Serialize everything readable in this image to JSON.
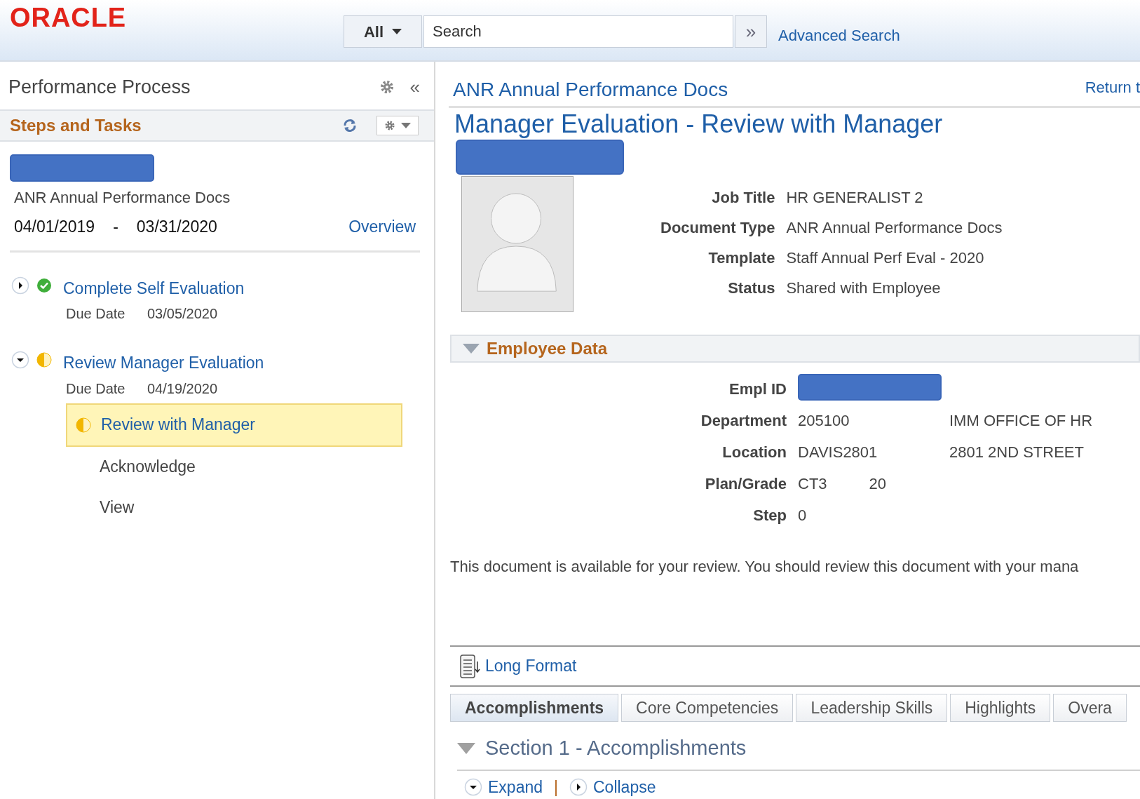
{
  "header": {
    "logo": "ORACLE",
    "search_scope": "All",
    "search": {
      "placeholder": "Search"
    },
    "search_go": "»",
    "advanced_search": "Advanced Search"
  },
  "sidebar": {
    "title": "Performance Process",
    "collapse": "«",
    "section": "Steps and Tasks",
    "document": "ANR Annual Performance Docs",
    "period_start": "04/01/2019",
    "period_sep": "-",
    "period_end": "03/31/2020",
    "overview": "Overview",
    "tasks": [
      {
        "title": "Complete Self Evaluation",
        "kind": "complete",
        "expanded": false,
        "due_label": "Due Date",
        "due": "03/05/2020"
      },
      {
        "title": "Review Manager Evaluation",
        "kind": "partial",
        "expanded": true,
        "due_label": "Due Date",
        "due": "04/19/2020",
        "steps": [
          {
            "label": "Review with Manager",
            "selected": true,
            "kind": "partial"
          },
          {
            "label": "Acknowledge",
            "selected": false,
            "kind": "pending"
          },
          {
            "label": "View",
            "selected": false,
            "kind": "pending"
          }
        ]
      }
    ]
  },
  "main": {
    "breadcrumb": "ANR Annual Performance Docs",
    "return_link": "Return t",
    "title": "Manager Evaluation - Review with Manager",
    "summary": [
      {
        "label": "Job Title",
        "value": "HR GENERALIST 2"
      },
      {
        "label": "Document Type",
        "value": "ANR Annual Performance Docs"
      },
      {
        "label": "Template",
        "value": "Staff Annual Perf Eval - 2020"
      },
      {
        "label": "Status",
        "value": "Shared with Employee"
      }
    ],
    "employee_section": {
      "title": "Employee Data",
      "expanded": true
    },
    "employee": [
      {
        "label": "Empl ID",
        "kind": "redacted"
      },
      {
        "label": "Department",
        "value": "205100",
        "extra": "IMM OFFICE OF HR"
      },
      {
        "label": "Location",
        "value": "DAVIS2801",
        "extra": "2801 2ND STREET"
      },
      {
        "label": "Plan/Grade",
        "value": "CT3",
        "value_2": "20"
      },
      {
        "label": "Step",
        "value": "0"
      }
    ],
    "message": "This document is available for your review. You should review this document with your mana",
    "long_format": "Long Format",
    "tabs": [
      {
        "label": "Accomplishments",
        "selected": true
      },
      {
        "label": "Core Competencies",
        "selected": false
      },
      {
        "label": "Leadership Skills",
        "selected": false
      },
      {
        "label": "Highlights",
        "selected": false
      },
      {
        "label": "Overa",
        "selected": false
      }
    ],
    "section": {
      "title": "Section 1 - Accomplishments",
      "expanded": true
    },
    "expand": "Expand",
    "separator": "|",
    "collapse": "Collapse"
  }
}
